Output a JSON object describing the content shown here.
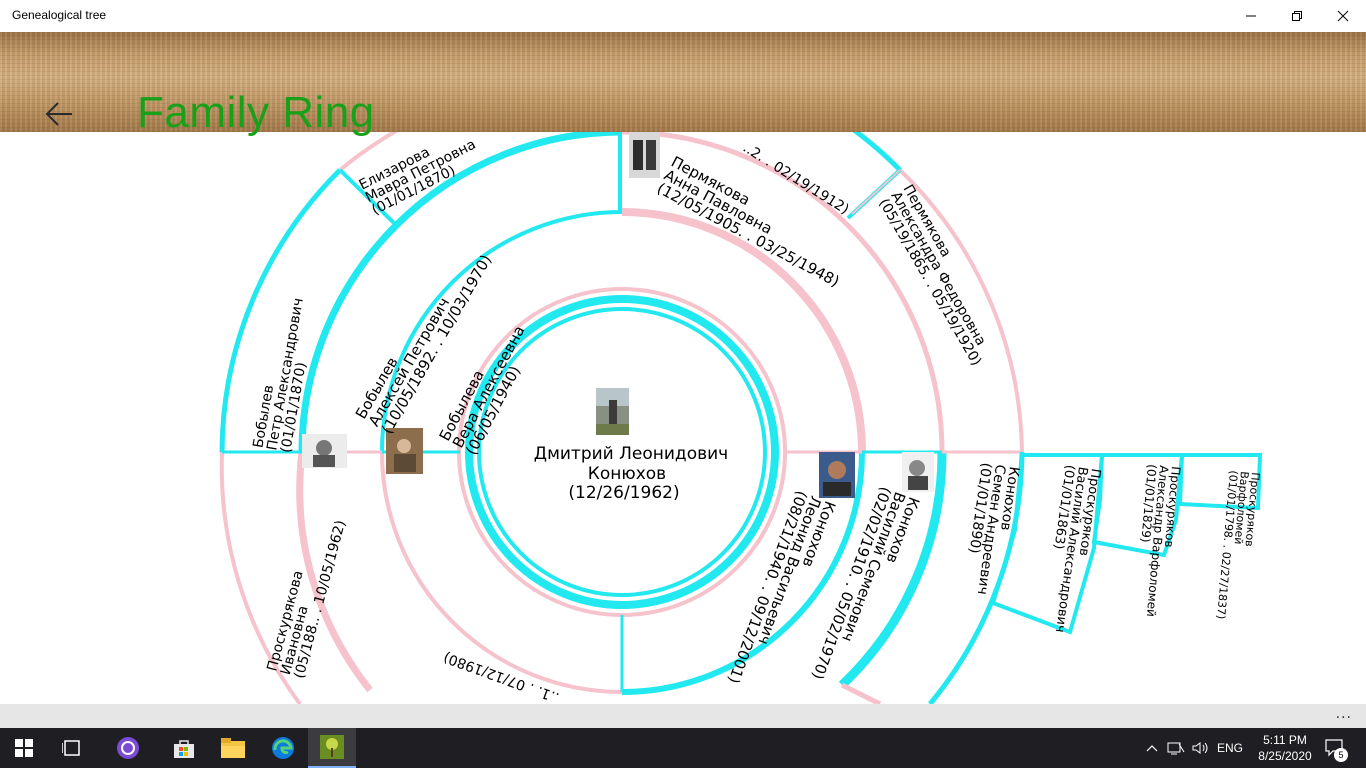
{
  "window": {
    "title": "Genealogical tree"
  },
  "header": {
    "title": "Family Ring",
    "back_icon": "back-arrow-icon"
  },
  "center_person": {
    "name": "Дмитрий Леонидович",
    "surname": "Конюхов",
    "dates": "(12/26/1962)"
  },
  "people": [
    {
      "id": "bobyleva-vera",
      "lines": [
        "Бобылева",
        "Вера Алексеевна",
        "(06/05/1940)"
      ]
    },
    {
      "id": "bobylev-aleksey",
      "lines": [
        "Бобылев",
        "Алексей Петрович",
        "(10/05/1892. . 10/03/1970)"
      ]
    },
    {
      "id": "bobylev-petr",
      "lines": [
        "Бобылев",
        "Петр Александрович",
        "(01/01/1870)"
      ]
    },
    {
      "id": "elizarova-mavra",
      "lines": [
        "Елизарова",
        "Мавра Петровна",
        "(01/01/1870)"
      ]
    },
    {
      "id": "permyakova-anna",
      "lines": [
        "Пермякова",
        "Анна Павловна",
        "(12/05/1905. . 03/25/1948)"
      ]
    },
    {
      "id": "top-partial",
      "lines": [
        "..2. . 02/19/1912)"
      ]
    },
    {
      "id": "permyakova-aleksandra",
      "lines": [
        "Пермякова",
        "Александра Федоровна",
        "(05/19/1865. . 05/19/1920)"
      ]
    },
    {
      "id": "konyuhov-leonid",
      "lines": [
        "Конюхов",
        "Леонид Васильевич",
        "(08/21/1940. . 09/12/2001)"
      ]
    },
    {
      "id": "konyuhov-vasiliy",
      "lines": [
        "Конюхов",
        "Василий Семенович",
        "(02/02/1910. . 05/02/1970)"
      ]
    },
    {
      "id": "konyuhov-semen",
      "lines": [
        "Конюхов",
        "Семен Андреевич",
        "(01/01/1890)"
      ]
    },
    {
      "id": "proskuryakov-vasiliy",
      "lines": [
        "Проскуряков",
        "Василий Александрович",
        "(01/01/1863)"
      ]
    },
    {
      "id": "proskuryakov-aleksandr",
      "lines": [
        "Проскуряков",
        "Александр Варфоломей",
        "(01/01/1829)"
      ]
    },
    {
      "id": "proskuryakov-varfolomey",
      "lines": [
        "Проскуряков",
        "Варфоломей",
        "(01/01/1798. . 02/27/1837)"
      ]
    },
    {
      "id": "bottom-partial-1",
      "lines": [
        "..1. . 07/12/1980)"
      ]
    },
    {
      "id": "proskuryakova-ivanovna",
      "lines": [
        "Проскурякова",
        "Ивановна",
        "(05/188.. . 10/05/1962)"
      ]
    }
  ],
  "taskbar": {
    "time": "5:11 PM",
    "date": "8/25/2020",
    "language": "ENG",
    "notifications": "5",
    "apps": [
      "windows-start-icon",
      "task-view-icon",
      "cortana-icon",
      "store-icon",
      "file-explorer-icon",
      "edge-icon",
      "genealogy-app-icon"
    ]
  },
  "appbar": {
    "more": "..."
  },
  "colors": {
    "cyan": "#22e8ef",
    "pink": "#f6c2cc",
    "title_green": "#18a018"
  }
}
